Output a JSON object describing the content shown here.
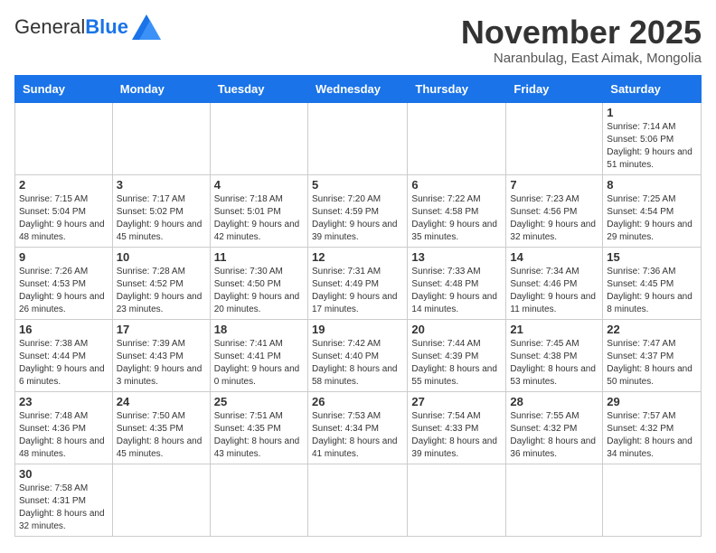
{
  "logo": {
    "general": "General",
    "blue": "Blue"
  },
  "title": "November 2025",
  "location": "Naranbulag, East Aimak, Mongolia",
  "days_of_week": [
    "Sunday",
    "Monday",
    "Tuesday",
    "Wednesday",
    "Thursday",
    "Friday",
    "Saturday"
  ],
  "weeks": [
    [
      {
        "day": "",
        "info": ""
      },
      {
        "day": "",
        "info": ""
      },
      {
        "day": "",
        "info": ""
      },
      {
        "day": "",
        "info": ""
      },
      {
        "day": "",
        "info": ""
      },
      {
        "day": "",
        "info": ""
      },
      {
        "day": "1",
        "info": "Sunrise: 7:14 AM\nSunset: 5:06 PM\nDaylight: 9 hours and 51 minutes."
      }
    ],
    [
      {
        "day": "2",
        "info": "Sunrise: 7:15 AM\nSunset: 5:04 PM\nDaylight: 9 hours and 48 minutes."
      },
      {
        "day": "3",
        "info": "Sunrise: 7:17 AM\nSunset: 5:02 PM\nDaylight: 9 hours and 45 minutes."
      },
      {
        "day": "4",
        "info": "Sunrise: 7:18 AM\nSunset: 5:01 PM\nDaylight: 9 hours and 42 minutes."
      },
      {
        "day": "5",
        "info": "Sunrise: 7:20 AM\nSunset: 4:59 PM\nDaylight: 9 hours and 39 minutes."
      },
      {
        "day": "6",
        "info": "Sunrise: 7:22 AM\nSunset: 4:58 PM\nDaylight: 9 hours and 35 minutes."
      },
      {
        "day": "7",
        "info": "Sunrise: 7:23 AM\nSunset: 4:56 PM\nDaylight: 9 hours and 32 minutes."
      },
      {
        "day": "8",
        "info": "Sunrise: 7:25 AM\nSunset: 4:54 PM\nDaylight: 9 hours and 29 minutes."
      }
    ],
    [
      {
        "day": "9",
        "info": "Sunrise: 7:26 AM\nSunset: 4:53 PM\nDaylight: 9 hours and 26 minutes."
      },
      {
        "day": "10",
        "info": "Sunrise: 7:28 AM\nSunset: 4:52 PM\nDaylight: 9 hours and 23 minutes."
      },
      {
        "day": "11",
        "info": "Sunrise: 7:30 AM\nSunset: 4:50 PM\nDaylight: 9 hours and 20 minutes."
      },
      {
        "day": "12",
        "info": "Sunrise: 7:31 AM\nSunset: 4:49 PM\nDaylight: 9 hours and 17 minutes."
      },
      {
        "day": "13",
        "info": "Sunrise: 7:33 AM\nSunset: 4:48 PM\nDaylight: 9 hours and 14 minutes."
      },
      {
        "day": "14",
        "info": "Sunrise: 7:34 AM\nSunset: 4:46 PM\nDaylight: 9 hours and 11 minutes."
      },
      {
        "day": "15",
        "info": "Sunrise: 7:36 AM\nSunset: 4:45 PM\nDaylight: 9 hours and 8 minutes."
      }
    ],
    [
      {
        "day": "16",
        "info": "Sunrise: 7:38 AM\nSunset: 4:44 PM\nDaylight: 9 hours and 6 minutes."
      },
      {
        "day": "17",
        "info": "Sunrise: 7:39 AM\nSunset: 4:43 PM\nDaylight: 9 hours and 3 minutes."
      },
      {
        "day": "18",
        "info": "Sunrise: 7:41 AM\nSunset: 4:41 PM\nDaylight: 9 hours and 0 minutes."
      },
      {
        "day": "19",
        "info": "Sunrise: 7:42 AM\nSunset: 4:40 PM\nDaylight: 8 hours and 58 minutes."
      },
      {
        "day": "20",
        "info": "Sunrise: 7:44 AM\nSunset: 4:39 PM\nDaylight: 8 hours and 55 minutes."
      },
      {
        "day": "21",
        "info": "Sunrise: 7:45 AM\nSunset: 4:38 PM\nDaylight: 8 hours and 53 minutes."
      },
      {
        "day": "22",
        "info": "Sunrise: 7:47 AM\nSunset: 4:37 PM\nDaylight: 8 hours and 50 minutes."
      }
    ],
    [
      {
        "day": "23",
        "info": "Sunrise: 7:48 AM\nSunset: 4:36 PM\nDaylight: 8 hours and 48 minutes."
      },
      {
        "day": "24",
        "info": "Sunrise: 7:50 AM\nSunset: 4:35 PM\nDaylight: 8 hours and 45 minutes."
      },
      {
        "day": "25",
        "info": "Sunrise: 7:51 AM\nSunset: 4:35 PM\nDaylight: 8 hours and 43 minutes."
      },
      {
        "day": "26",
        "info": "Sunrise: 7:53 AM\nSunset: 4:34 PM\nDaylight: 8 hours and 41 minutes."
      },
      {
        "day": "27",
        "info": "Sunrise: 7:54 AM\nSunset: 4:33 PM\nDaylight: 8 hours and 39 minutes."
      },
      {
        "day": "28",
        "info": "Sunrise: 7:55 AM\nSunset: 4:32 PM\nDaylight: 8 hours and 36 minutes."
      },
      {
        "day": "29",
        "info": "Sunrise: 7:57 AM\nSunset: 4:32 PM\nDaylight: 8 hours and 34 minutes."
      }
    ],
    [
      {
        "day": "30",
        "info": "Sunrise: 7:58 AM\nSunset: 4:31 PM\nDaylight: 8 hours and 32 minutes."
      },
      {
        "day": "",
        "info": ""
      },
      {
        "day": "",
        "info": ""
      },
      {
        "day": "",
        "info": ""
      },
      {
        "day": "",
        "info": ""
      },
      {
        "day": "",
        "info": ""
      },
      {
        "day": "",
        "info": ""
      }
    ]
  ]
}
